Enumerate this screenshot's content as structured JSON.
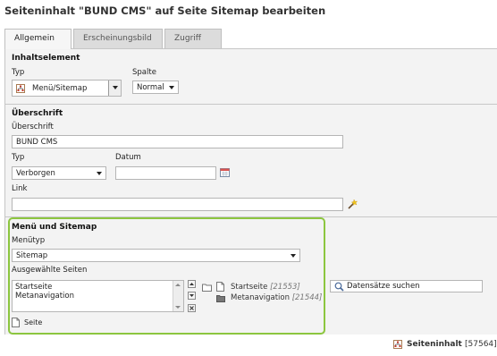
{
  "page": {
    "title": "Seiteninhalt \"BUND CMS\" auf Seite Sitemap bearbeiten"
  },
  "tabs": [
    {
      "label": "Allgemein"
    },
    {
      "label": "Erscheinungsbild"
    },
    {
      "label": "Zugriff"
    }
  ],
  "inhaltselement": {
    "title": "Inhaltselement",
    "typ_label": "Typ",
    "typ_value": "Menü/Sitemap",
    "spalte_label": "Spalte",
    "spalte_value": "Normal"
  },
  "ueberschrift": {
    "title": "Überschrift",
    "field_label": "Überschrift",
    "field_value": "BUND CMS",
    "typ_label": "Typ",
    "typ_value": "Verborgen",
    "datum_label": "Datum",
    "datum_value": "",
    "link_label": "Link",
    "link_value": ""
  },
  "menue": {
    "title": "Menü und Sitemap",
    "menuetyp_label": "Menütyp",
    "menuetyp_value": "Sitemap",
    "selected_label": "Ausgewählte Seiten",
    "selected_items": [
      "Startseite",
      "Metanavigation"
    ],
    "tree": [
      {
        "name": "Startseite",
        "uid": "[21553]"
      },
      {
        "name": "Metanavigation",
        "uid": "[21544]"
      }
    ],
    "add_page_label": "Seite",
    "search_value": "Datensätze suchen"
  },
  "footer": {
    "record_label": "Seiteninhalt",
    "record_uid": "[57564]"
  },
  "colors": {
    "highlight_border": "#8cc63f",
    "panel_bg": "#f3f3f3"
  }
}
